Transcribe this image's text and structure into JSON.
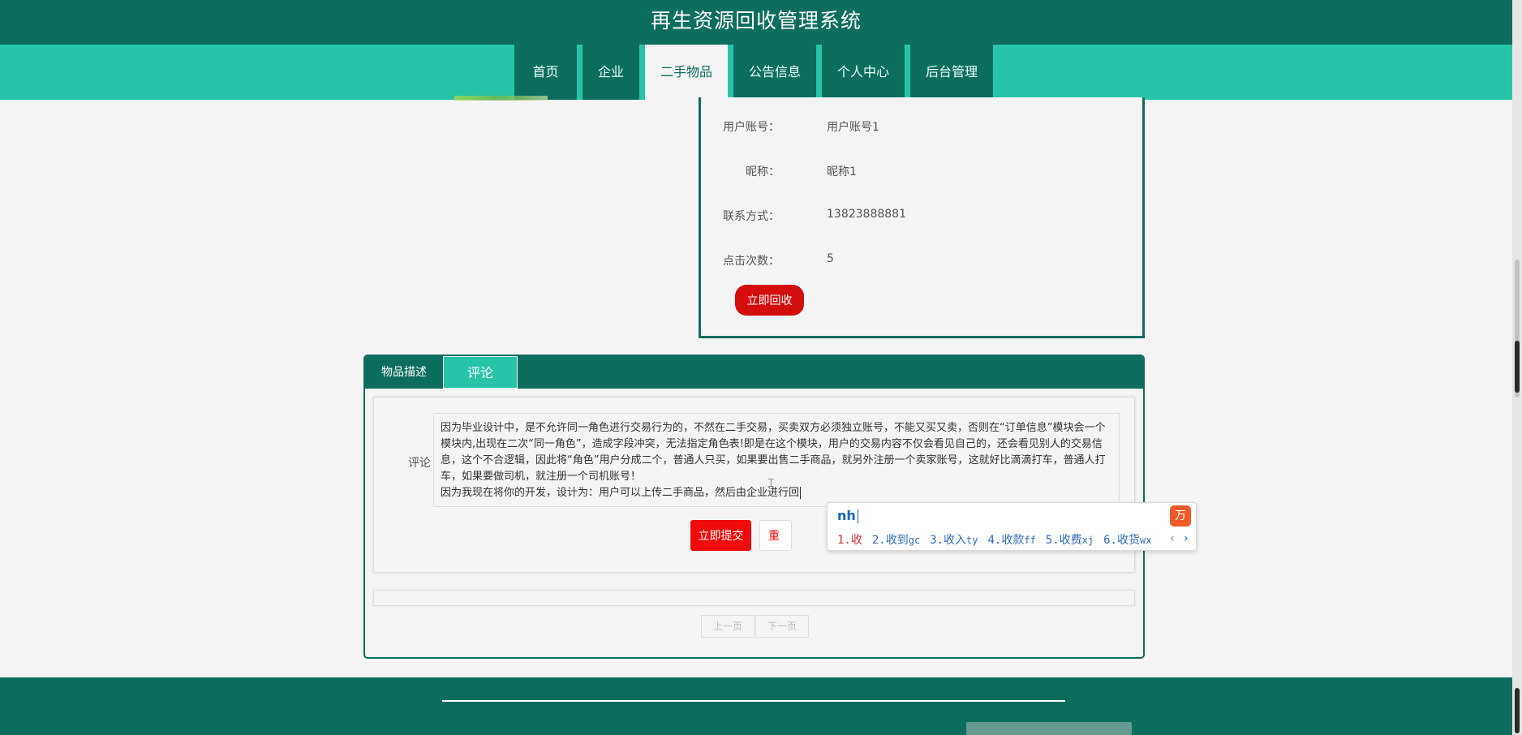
{
  "header": {
    "title": "再生资源回收管理系统"
  },
  "nav": {
    "items": [
      {
        "label": "首页",
        "width": 77
      },
      {
        "label": "企业",
        "width": 70
      },
      {
        "label": "二手物品",
        "width": 102
      },
      {
        "label": "公告信息",
        "width": 102
      },
      {
        "label": "个人中心",
        "width": 102
      },
      {
        "label": "后台管理",
        "width": 102
      }
    ],
    "active": "二手物品"
  },
  "item_info": {
    "fields": [
      {
        "label": "用户账号：",
        "value": "用户账号1"
      },
      {
        "label": "昵称：",
        "value": "昵称1"
      },
      {
        "label": "联系方式：",
        "value": "13823888881"
      },
      {
        "label": "点击次数：",
        "value": "5"
      }
    ],
    "recycle_button": "立即回收"
  },
  "tabs": {
    "items": [
      "物品描述",
      "评论"
    ],
    "active": "评论"
  },
  "comment": {
    "label": "评论",
    "text_lines": [
      "因为毕业设计中，是不允许同一角色进行交易行为的，不然在二手交易，买卖双方必须独立账号，不能又买又卖，否则在“订单信息”模块会一个模块内,出现在二次“同一角色”，造成字段冲突，无法指定角色表!即是在这个模块，用户的交易内容不仅会看见自己的，还会看见别人的交易信息，这个不合逻辑，因此将“角色”用户分成二个，普通人只买，如果要出售二手商品，就另外注册一个卖家账号，这就好比滴滴打车，普通人打车，如果要做司机，就注册一个司机账号！",
      "因为我现在将你的开发，设计为：用户可以上传二手商品，然后由企业进行回"
    ],
    "submit_button": "立即提交",
    "reset_button": "重"
  },
  "pager": {
    "prev": "上一页",
    "next": "下一页"
  },
  "ime": {
    "composition": "nh",
    "logo": "万",
    "candidates": [
      {
        "index": "1.",
        "text": "收",
        "suffix": ""
      },
      {
        "index": "2.",
        "text": "收到",
        "suffix": "gc"
      },
      {
        "index": "3.",
        "text": "收入",
        "suffix": "ty"
      },
      {
        "index": "4.",
        "text": "收款",
        "suffix": "ff"
      },
      {
        "index": "5.",
        "text": "收费",
        "suffix": "xj"
      },
      {
        "index": "6.",
        "text": "收货",
        "suffix": "wx"
      }
    ],
    "prev_arrow": "‹",
    "next_arrow": "›"
  },
  "colors": {
    "primary": "#0e6e5e",
    "accent": "#28c4a8",
    "danger": "#d40d0d"
  }
}
